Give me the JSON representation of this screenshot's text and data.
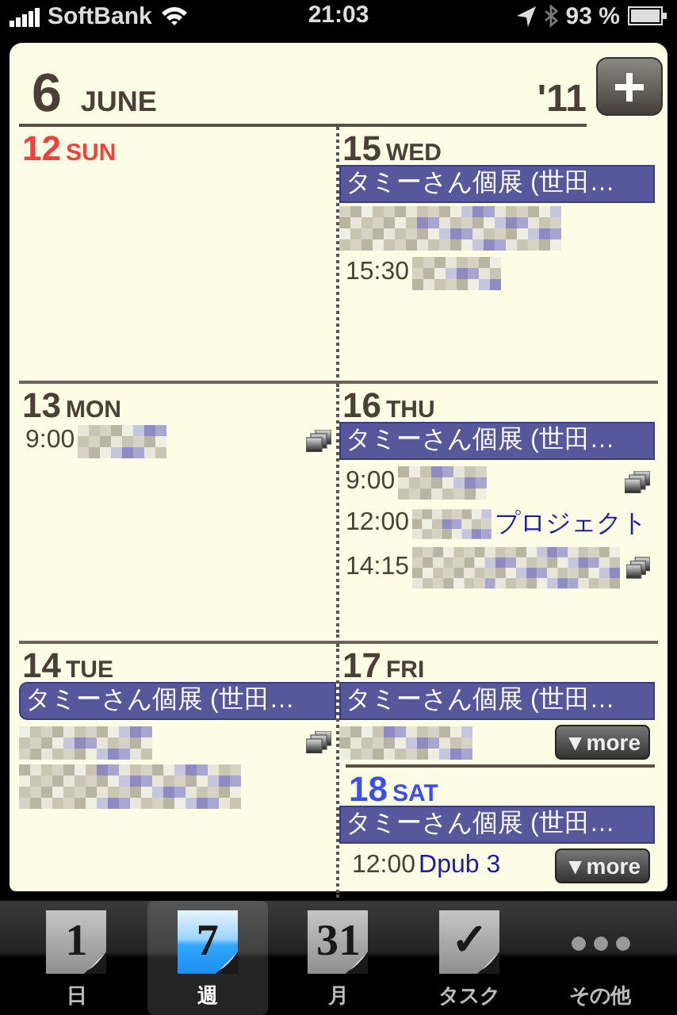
{
  "status_bar": {
    "carrier": "SoftBank",
    "time": "21:03",
    "battery": "93 %"
  },
  "header": {
    "day": "6",
    "month": "JUNE",
    "year": "'11"
  },
  "rows": [
    {
      "columns": [
        {
          "days": [
            {
              "number": "12",
              "weekday": "SUN",
              "kind": "sunday"
            }
          ]
        },
        {
          "days": [
            {
              "number": "15",
              "weekday": "WED",
              "kind": "weekday",
              "events": [
                {
                  "kind": "allday",
                  "title": "タミーさん個展 (世田…"
                },
                {
                  "kind": "redacted",
                  "redacted": true
                },
                {
                  "kind": "timed",
                  "time": "15:30",
                  "redacted": true
                }
              ]
            }
          ]
        }
      ]
    },
    {
      "columns": [
        {
          "days": [
            {
              "number": "13",
              "weekday": "MON",
              "kind": "weekday",
              "events": [
                {
                  "kind": "timed",
                  "time": "9:00",
                  "redacted": true,
                  "repeat": true
                }
              ]
            }
          ]
        },
        {
          "days": [
            {
              "number": "16",
              "weekday": "THU",
              "kind": "weekday",
              "events": [
                {
                  "kind": "allday",
                  "title": "タミーさん個展 (世田…"
                },
                {
                  "kind": "timed",
                  "time": "9:00",
                  "redacted": true,
                  "repeat": true
                },
                {
                  "kind": "timed",
                  "time": "12:00",
                  "redacted": true,
                  "title": "プロジェクト"
                },
                {
                  "kind": "timed",
                  "time": "14:15",
                  "redacted": true,
                  "repeat": true
                }
              ]
            }
          ]
        }
      ]
    },
    {
      "columns": [
        {
          "days": [
            {
              "number": "14",
              "weekday": "TUE",
              "kind": "weekday",
              "events": [
                {
                  "kind": "allday",
                  "title": "タミーさん個展 (世田…"
                },
                {
                  "kind": "redacted",
                  "redacted": true,
                  "repeat": true
                },
                {
                  "kind": "redacted",
                  "redacted": true
                }
              ]
            }
          ]
        },
        {
          "days": [
            {
              "number": "17",
              "weekday": "FRI",
              "kind": "weekday",
              "more": "▼more",
              "events": [
                {
                  "kind": "allday",
                  "title": "タミーさん個展 (世田…"
                },
                {
                  "kind": "redacted",
                  "redacted": true
                }
              ]
            },
            {
              "number": "18",
              "weekday": "SAT",
              "kind": "saturday",
              "more": "▼more",
              "events": [
                {
                  "kind": "allday",
                  "title": "タミーさん個展 (世田…"
                },
                {
                  "kind": "timed",
                  "time": "12:00",
                  "title": "Dpub 3"
                }
              ]
            }
          ]
        }
      ]
    }
  ],
  "tabs": [
    {
      "icon_text": "1",
      "label": "日",
      "selected": false
    },
    {
      "icon_text": "7",
      "label": "週",
      "selected": true
    },
    {
      "icon_text": "31",
      "label": "月",
      "selected": false
    },
    {
      "icon_text": "✓",
      "label": "タスク",
      "selected": false
    },
    {
      "kind": "dots",
      "label": "その他",
      "selected": false
    }
  ]
}
